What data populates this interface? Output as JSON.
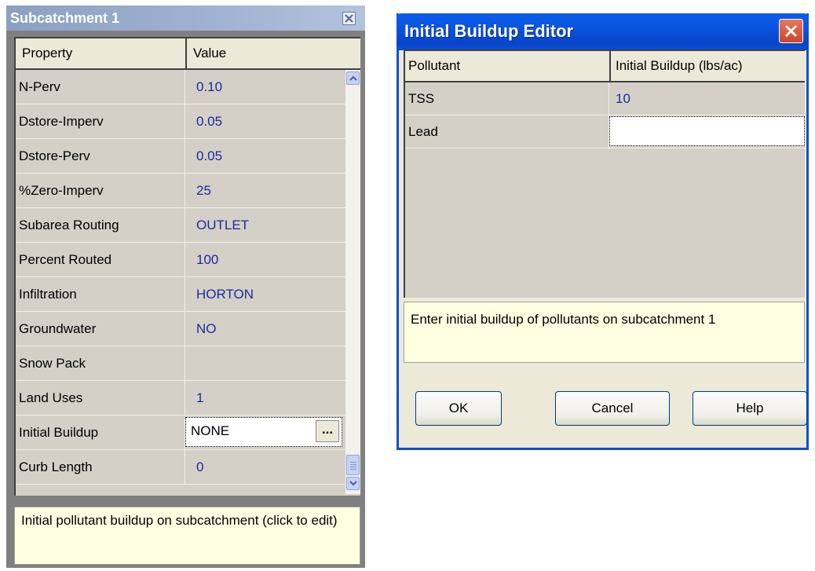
{
  "subcatchment_window": {
    "title": "Subcatchment 1",
    "columns": {
      "property": "Property",
      "value": "Value"
    },
    "rows": [
      {
        "property": "N-Perv",
        "value": "0.10"
      },
      {
        "property": "Dstore-Imperv",
        "value": "0.05"
      },
      {
        "property": "Dstore-Perv",
        "value": "0.05"
      },
      {
        "property": "%Zero-Imperv",
        "value": "25"
      },
      {
        "property": "Subarea Routing",
        "value": "OUTLET"
      },
      {
        "property": "Percent Routed",
        "value": "100"
      },
      {
        "property": "Infiltration",
        "value": "HORTON"
      },
      {
        "property": "Groundwater",
        "value": "NO"
      },
      {
        "property": "Snow Pack",
        "value": ""
      },
      {
        "property": "Land Uses",
        "value": "1"
      },
      {
        "property": "Initial Buildup",
        "value": "NONE"
      },
      {
        "property": "Curb Length",
        "value": "0"
      }
    ],
    "ellipsis_button": "...",
    "description": "Initial pollutant buildup on subcatchment (click to edit)",
    "icons": [
      "close-icon",
      "scroll-up-icon",
      "scroll-down-icon"
    ]
  },
  "buildup_editor": {
    "title": "Initial Buildup Editor",
    "columns": {
      "pollutant": "Pollutant",
      "buildup": "Initial Buildup (lbs/ac)"
    },
    "rows": [
      {
        "pollutant": "TSS",
        "buildup": "10"
      },
      {
        "pollutant": "Lead",
        "buildup": ""
      }
    ],
    "description": "Enter initial buildup of pollutants on subcatchment 1",
    "buttons": {
      "ok": "OK",
      "cancel": "Cancel",
      "help": "Help"
    },
    "icons": [
      "close-icon"
    ]
  },
  "colors": {
    "value_text": "#1b2a9c",
    "grid_background": "#d4d0c8",
    "hint_background": "#ffffe1",
    "xp_titlebar": "#0a56e0",
    "inactive_titlebar": "#a5b6d6"
  }
}
